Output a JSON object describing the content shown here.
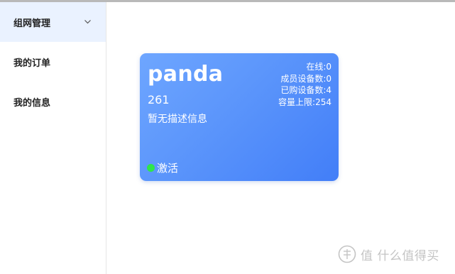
{
  "sidebar": {
    "items": [
      {
        "label": "组网管理",
        "expanded": true
      },
      {
        "label": "我的订单"
      },
      {
        "label": "我的信息"
      }
    ]
  },
  "network_card": {
    "name": "panda",
    "id": "261",
    "description": "暂无描述信息",
    "stats": {
      "online": "在线:0",
      "member_devices": "成员设备数:0",
      "purchased_devices": "已购设备数:4",
      "capacity_limit": "容量上限:254"
    },
    "status": "激活",
    "status_color": "#2ee64a"
  },
  "watermark": {
    "text": "值 什么值得买"
  }
}
